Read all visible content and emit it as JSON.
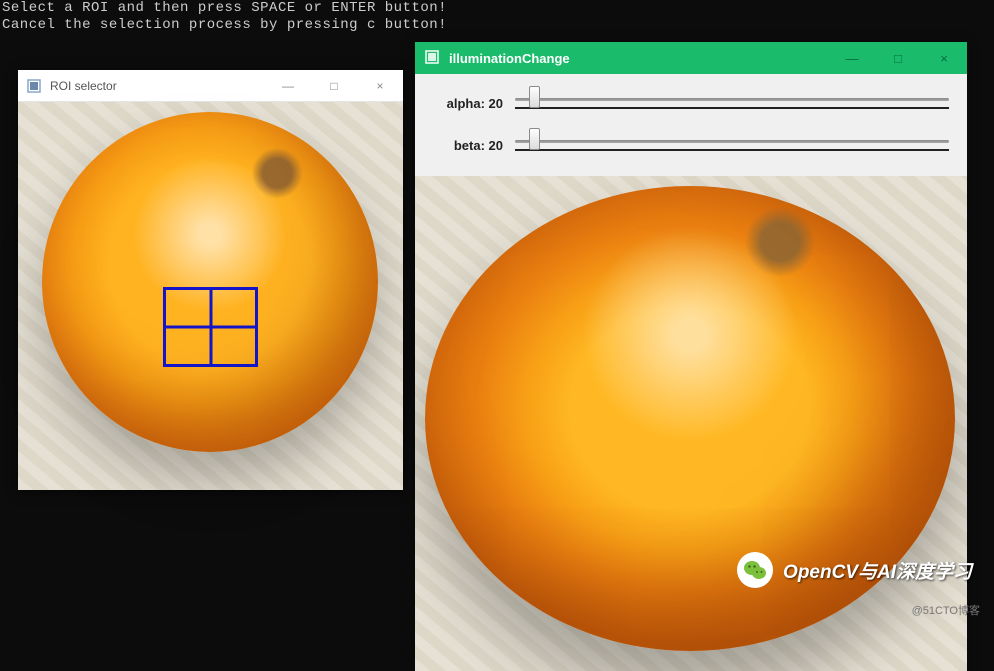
{
  "console": {
    "line1": "Select a ROI and then press SPACE or ENTER button!",
    "line2": "Cancel the selection process by pressing c button!"
  },
  "roi_window": {
    "title": "ROI selector",
    "minimize": "—",
    "maximize": "□",
    "close": "×"
  },
  "illum_window": {
    "title": "illuminationChange",
    "minimize": "—",
    "maximize": "□",
    "close": "×",
    "trackbars": {
      "alpha_label": "alpha: 20",
      "alpha_value": 20,
      "beta_label": "beta: 20",
      "beta_value": 20
    }
  },
  "watermark": {
    "wechat_text": "OpenCV与AI深度学习",
    "corner_text": "@51CTO博客"
  }
}
